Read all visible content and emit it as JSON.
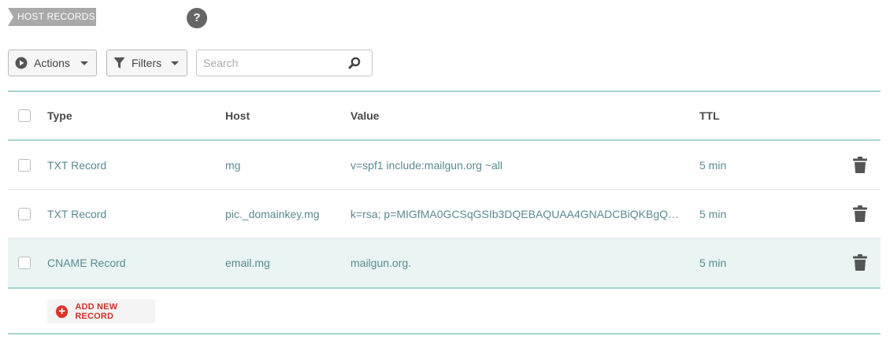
{
  "section": {
    "title": "HOST RECORDS",
    "help": "?"
  },
  "toolbar": {
    "actions_label": "Actions",
    "filters_label": "Filters",
    "search_placeholder": "Search"
  },
  "table": {
    "columns": {
      "type": "Type",
      "host": "Host",
      "value": "Value",
      "ttl": "TTL"
    },
    "rows": [
      {
        "type": "TXT Record",
        "host": "mg",
        "value": "v=spf1 include:mailgun.org ~all",
        "ttl": "5 min"
      },
      {
        "type": "TXT Record",
        "host": "pic._domainkey.mg",
        "value": "k=rsa; p=MIGfMA0GCSqGSIb3DQEBAQUAA4GNADCBiQKBgQD..",
        "ttl": "5 min"
      },
      {
        "type": "CNAME Record",
        "host": "email.mg",
        "value": "mailgun.org.",
        "ttl": "5 min"
      }
    ]
  },
  "add_record": {
    "label": "ADD NEW RECORD",
    "plus": "+"
  },
  "colors": {
    "accent_teal": "#a9d5cf",
    "row_highlight": "#e9f4f3",
    "add_red": "#e0302a",
    "link_text": "#5b8a92"
  },
  "icons": [
    "play-circle-icon",
    "funnel-icon",
    "search-icon",
    "trash-icon",
    "plus-circle-icon",
    "help-icon"
  ]
}
